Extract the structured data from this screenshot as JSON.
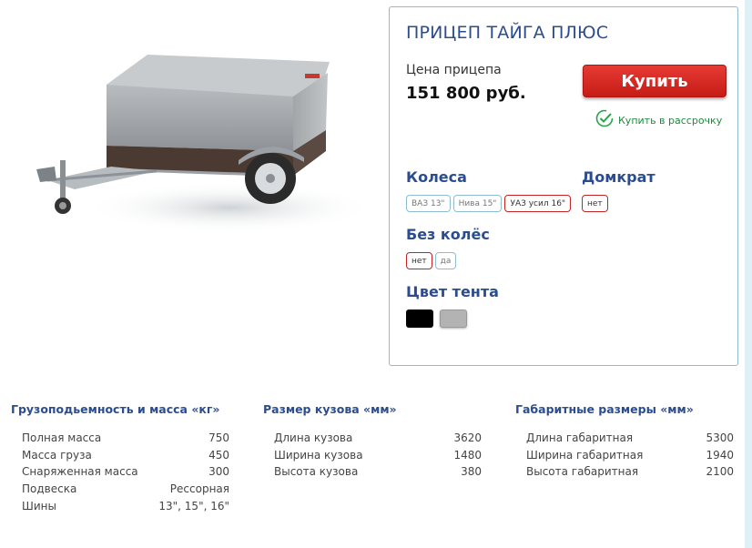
{
  "product": {
    "title": "ПРИЦЕП ТАЙГА ПЛЮС",
    "price_label": "Цена прицепа",
    "price_value": "151 800 руб.",
    "buy_label": "Купить",
    "installment_label": "Купить в рассрочку"
  },
  "options": {
    "wheels": {
      "label": "Колеса",
      "items": [
        "ВАЗ 13\"",
        "Нива 15\"",
        "УАЗ усил 16\""
      ],
      "selected": "УАЗ усил 16\""
    },
    "jack": {
      "label": "Домкрат",
      "items": [
        "нет"
      ],
      "selected": "нет"
    },
    "no_wheels": {
      "label": "Без колёс",
      "items": [
        "нет",
        "да"
      ],
      "selected": "нет"
    },
    "tent_color": {
      "label": "Цвет тента",
      "colors": [
        "#000000",
        "#b3b3b3"
      ]
    }
  },
  "specs": [
    {
      "heading": "Грузоподьемность и масса «кг»",
      "rows": [
        {
          "name": "Полная масса",
          "value": "750"
        },
        {
          "name": "Масса груза",
          "value": "450"
        },
        {
          "name": "Снаряженная масса",
          "value": "300"
        },
        {
          "name": "Подвеска",
          "value": "Рессорная"
        },
        {
          "name": "Шины",
          "value": "13\", 15\", 16\""
        }
      ]
    },
    {
      "heading": "Размер кузова «мм»",
      "rows": [
        {
          "name": "Длина кузова",
          "value": "3620"
        },
        {
          "name": "Ширина кузова",
          "value": "1480"
        },
        {
          "name": "Высота кузова",
          "value": "380"
        }
      ]
    },
    {
      "heading": "Габаритные размеры «мм»",
      "rows": [
        {
          "name": "Длина габаритная",
          "value": "5300"
        },
        {
          "name": "Ширина габаритная",
          "value": "1940"
        },
        {
          "name": "Высота габаритная",
          "value": "2100"
        }
      ]
    }
  ],
  "colors": {
    "accent": "#2b4d8f",
    "buy_button": "#d32a23",
    "panel_border": "#8fbcd0",
    "installment_green": "#1e8a3c"
  }
}
